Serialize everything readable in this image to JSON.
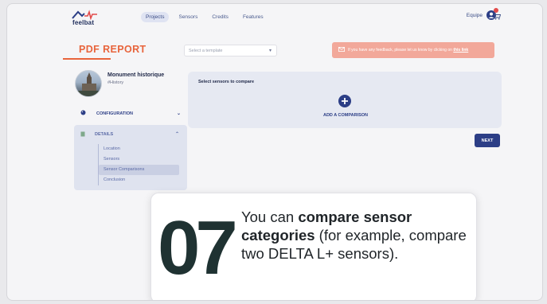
{
  "nav": {
    "logo_text": "feelbat",
    "links": [
      "Projects",
      "Sensors",
      "Credits",
      "Features"
    ],
    "active_link": "Projects",
    "team_label": "Equipe",
    "notification_count": "1"
  },
  "header": {
    "title": "PDF REPORT",
    "template_placeholder": "Select a template",
    "feedback_text": "If you have any feedback, please let us know by clicking on ",
    "feedback_link": "this link"
  },
  "profile": {
    "name": "Monument historique",
    "tag": "#History"
  },
  "sidebar": {
    "configuration_label": "CONFIGURATION",
    "details_label": "DETAILS",
    "details_items": [
      "Location",
      "Sensors",
      "Sensor Comparisons",
      "Conclusion"
    ],
    "selected_item": "Sensor Comparisons"
  },
  "main": {
    "compare_heading": "Select sensors to compare",
    "add_label": "ADD A COMPARISON",
    "next_label": "NEXT"
  },
  "callout": {
    "step": "07",
    "text_1": "You can ",
    "bold_1": "compare sensor categories",
    "text_2": " (for example, compare two DELTA L+ sensors)."
  },
  "colors": {
    "accent": "#e8643c",
    "brand": "#2c3e86",
    "banner": "#f2a89a"
  }
}
